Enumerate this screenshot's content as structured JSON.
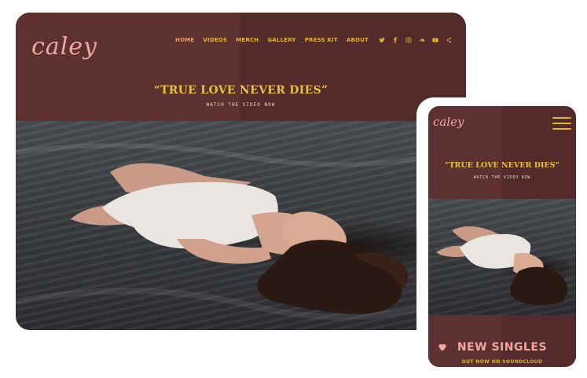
{
  "site": {
    "logo": "caley"
  },
  "nav": {
    "items": [
      {
        "label": "HOME",
        "active": true
      },
      {
        "label": "VIDEOS"
      },
      {
        "label": "MERCH"
      },
      {
        "label": "GALLERY"
      },
      {
        "label": "PRESS KIT"
      },
      {
        "label": "ABOUT"
      }
    ],
    "social": [
      "twitter-icon",
      "facebook-icon",
      "instagram-icon",
      "soundcloud-icon",
      "youtube-icon",
      "share-icon"
    ]
  },
  "hero": {
    "headline": "“TRUE LOVE NEVER DIES”",
    "subline": "WATCH THE VIDEO NOW"
  },
  "mobile": {
    "logo": "caley",
    "headline": "“TRUE LOVE NEVER DIES”",
    "subline": "WATCH THE VIDEO NOW",
    "section_title": "NEW SINGLES",
    "section_sub": "OUT NOW ON SOUNDCLOUD"
  },
  "colors": {
    "background": "#5a2d2d",
    "accent_gold": "#e1b62a",
    "accent_pink": "#f2a7a0",
    "active_nav": "#eb9a6e"
  }
}
